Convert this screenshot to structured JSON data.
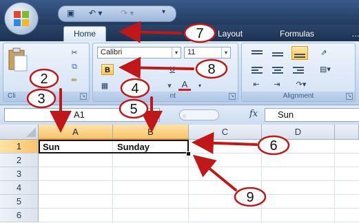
{
  "quick_access": {
    "icons": [
      "save-icon",
      "undo-icon",
      "redo-icon",
      "customize-icon"
    ]
  },
  "tabs": [
    "Home",
    "Layout",
    "Formulas"
  ],
  "ribbon": {
    "font_name": "Calibri",
    "font_size": "11",
    "bold_label": "B",
    "font_color_label": "A",
    "group_clipboard": "Cli",
    "group_font": "nt",
    "group_alignment": "Alignment"
  },
  "formula_bar": {
    "name_box": "A1",
    "fx": "fx",
    "value": "Sun"
  },
  "columns": [
    "A",
    "B",
    "C",
    "D"
  ],
  "rows": [
    "1",
    "2",
    "3",
    "4",
    "5",
    "6"
  ],
  "cells": {
    "A1": "Sun",
    "B1": "Sunday"
  },
  "annotations": {
    "callouts": [
      "2",
      "3",
      "4",
      "5",
      "6",
      "7",
      "8",
      "9"
    ],
    "arrow_color": "#c01818",
    "badge_color": "#c01818"
  }
}
